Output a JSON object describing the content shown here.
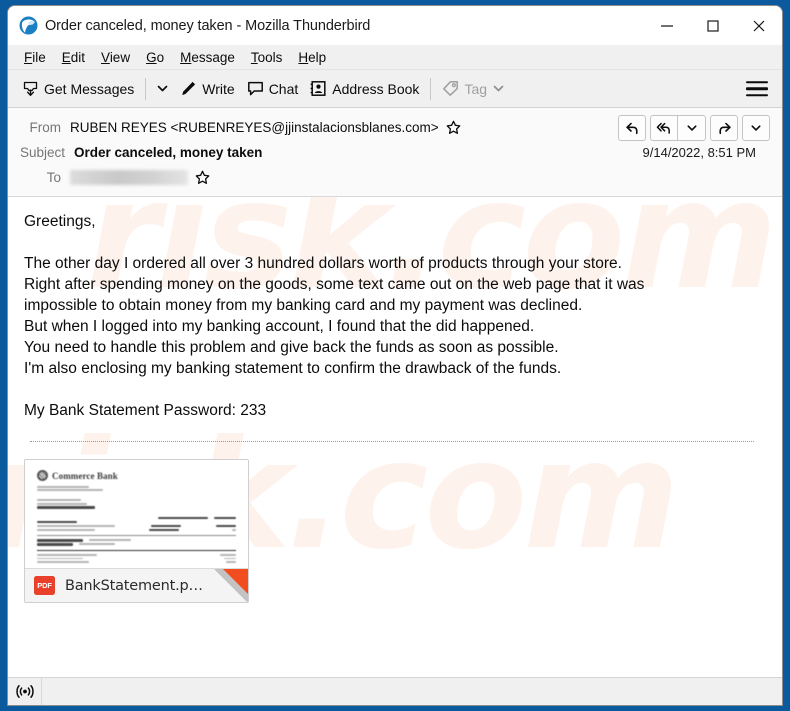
{
  "window": {
    "title": "Order canceled, money taken - Mozilla Thunderbird",
    "logo_icon": "thunderbird-logo-icon",
    "controls": {
      "minimize": "minimize-icon",
      "maximize": "maximize-icon",
      "close": "close-icon"
    }
  },
  "menubar": {
    "items": [
      {
        "label": "File",
        "accesskey": "F"
      },
      {
        "label": "Edit",
        "accesskey": "E"
      },
      {
        "label": "View",
        "accesskey": "V"
      },
      {
        "label": "Go",
        "accesskey": "G"
      },
      {
        "label": "Message",
        "accesskey": "M"
      },
      {
        "label": "Tools",
        "accesskey": "T"
      },
      {
        "label": "Help",
        "accesskey": "H"
      }
    ]
  },
  "toolbar": {
    "get_messages": "Get Messages",
    "get_messages_icon": "download-inbox-icon",
    "get_messages_caret": "chevron-down-icon",
    "write": "Write",
    "write_icon": "pencil-icon",
    "chat": "Chat",
    "chat_icon": "speech-bubble-icon",
    "address_book": "Address Book",
    "address_book_icon": "contact-card-icon",
    "tag": "Tag",
    "tag_icon": "tag-icon",
    "tag_caret": "chevron-down-icon",
    "tag_disabled": true,
    "app_menu_icon": "hamburger-menu-icon"
  },
  "message_header": {
    "from_label": "From",
    "from_value": "RUBEN REYES <RUBENREYES@jjinstalacionsblanes.com>",
    "from_star_icon": "star-outline-icon",
    "subject_label": "Subject",
    "subject_value": "Order canceled, money taken",
    "date": "9/14/2022, 8:51 PM",
    "to_label": "To",
    "to_value_redacted": true,
    "to_star_icon": "star-outline-icon",
    "actions": [
      {
        "name": "reply-button",
        "icon": "reply-arrow-icon"
      },
      {
        "name": "reply-all-button",
        "icon": "reply-all-arrow-icon"
      },
      {
        "name": "reply-more-button",
        "icon": "chevron-down-icon"
      },
      {
        "name": "forward-button",
        "icon": "forward-arrow-icon"
      },
      {
        "name": "more-actions-button",
        "icon": "chevron-down-icon"
      }
    ]
  },
  "body": {
    "watermark_text": "risk.com",
    "lines": [
      "Greetings,",
      "",
      "The other day I ordered all over 3 hundred dollars worth of products through your store.",
      "Right after spending money on the goods, some text came out on the web page that it was",
      "impossible to obtain money from my banking card and my payment was declined.",
      "But when I logged into my banking account, I found that the did happened.",
      "You need to handle this problem and give back the funds as soon as possible.",
      "I'm also enclosing my banking statement to confirm the drawback of the funds.",
      "",
      "My Bank Statement Password: 233"
    ]
  },
  "attachment": {
    "filename": "BankStatement.p…",
    "filetype_badge": "PDF",
    "filetype_icon": "pdf-file-icon",
    "preview_alt": "bank-statement-preview",
    "preview": {
      "bank_name": "Commerce Bank"
    }
  },
  "statusbar": {
    "icon": "broadcast-antenna-icon"
  },
  "colors": {
    "window_border": "#0c5a9e",
    "toolbar_bg": "#f0f0f0",
    "header_bg": "#fafafa",
    "pdf_red": "#e8402a",
    "fold_red": "#f24d1e",
    "label_gray": "#767676",
    "watermark": "#f37335"
  }
}
